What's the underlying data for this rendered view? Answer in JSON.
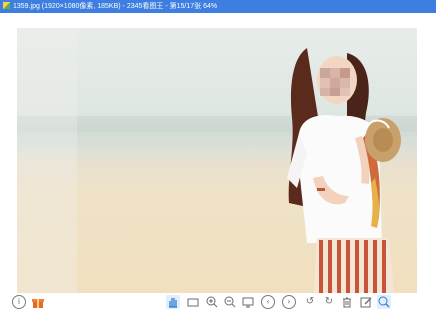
{
  "window": {
    "title": "1359.jpg  (1920×1080像素, 185KB) - 2345看图王 - 第15/17张 64%"
  },
  "photo": {
    "description_colors": {
      "sky": "#e7ece8",
      "sea": "#cfdad4",
      "sand": "#efe2c6",
      "dress": "#ffffff",
      "skirt_stripe": "#c8553a"
    }
  },
  "toolbar": {
    "items": [
      {
        "name": "info-icon",
        "glyph": "ⓘ"
      },
      {
        "name": "gift-icon",
        "glyph": "🎁"
      },
      {
        "name": "pan-hand-icon",
        "glyph": "✋"
      },
      {
        "name": "actual-size-icon",
        "glyph": "1:1"
      },
      {
        "name": "zoom-in-icon",
        "glyph": "⊕"
      },
      {
        "name": "zoom-out-icon",
        "glyph": "⊖"
      },
      {
        "name": "slideshow-icon",
        "glyph": "▣"
      },
      {
        "name": "previous-icon",
        "glyph": "‹"
      },
      {
        "name": "next-icon",
        "glyph": "›"
      },
      {
        "name": "rotate-left-icon",
        "glyph": "↺"
      },
      {
        "name": "rotate-right-icon",
        "glyph": "↻"
      },
      {
        "name": "delete-icon",
        "glyph": "🗑"
      },
      {
        "name": "edit-icon",
        "glyph": "✎"
      },
      {
        "name": "search-zoom-icon",
        "glyph": "🔍"
      }
    ]
  }
}
